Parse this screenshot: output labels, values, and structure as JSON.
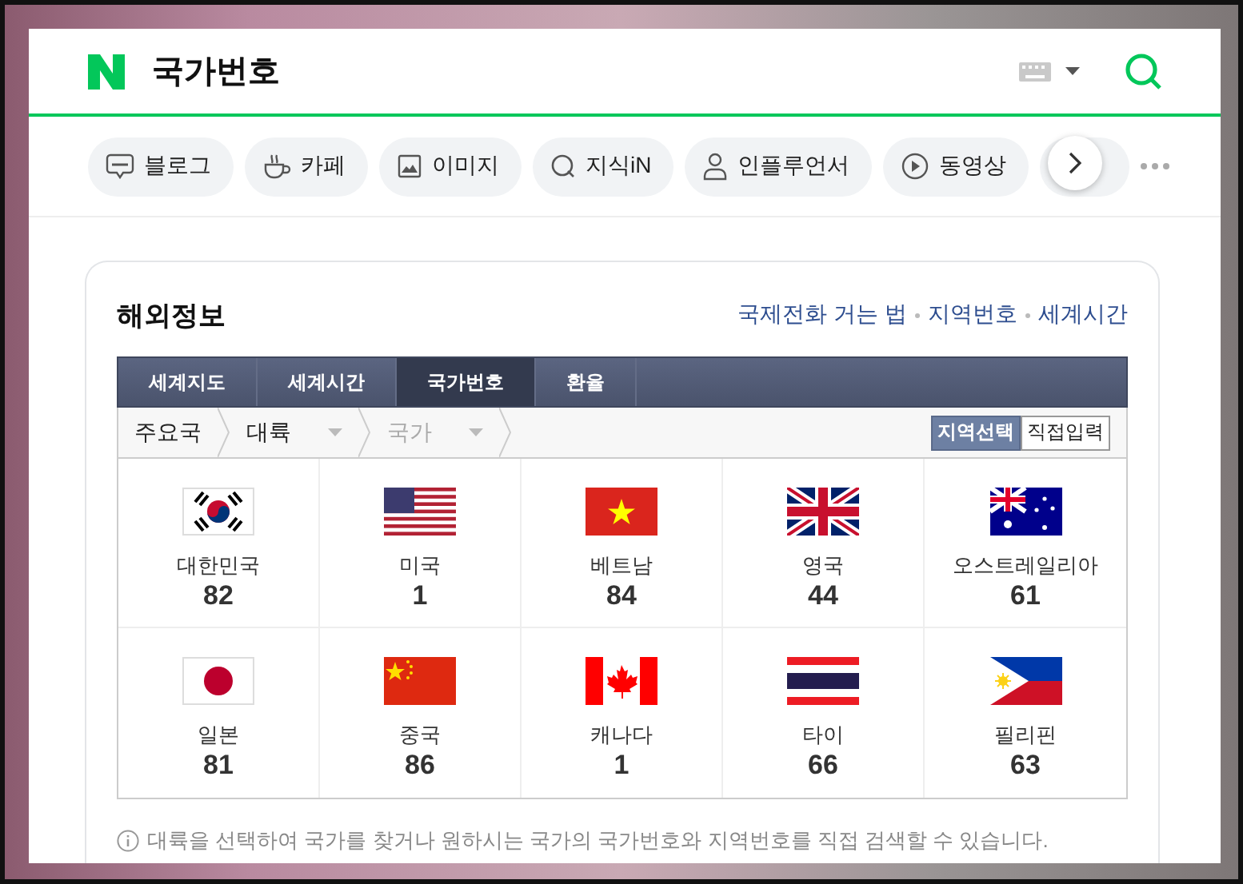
{
  "header": {
    "query": "국가번호"
  },
  "chips": [
    {
      "label": "블로그"
    },
    {
      "label": "카페"
    },
    {
      "label": "이미지"
    },
    {
      "label": "지식iN"
    },
    {
      "label": "인플루언서"
    },
    {
      "label": "동영상"
    }
  ],
  "card": {
    "title": "해외정보",
    "links": [
      "국제전화 거는 법",
      "지역번호",
      "세계시간"
    ],
    "tabs": [
      {
        "label": "세계지도",
        "selected": false
      },
      {
        "label": "세계시간",
        "selected": false
      },
      {
        "label": "국가번호",
        "selected": true
      },
      {
        "label": "환율",
        "selected": false
      }
    ],
    "filters": [
      {
        "label": "주요국",
        "kind": "crumb",
        "disabled": false
      },
      {
        "label": "대륙",
        "kind": "select",
        "disabled": false
      },
      {
        "label": "국가",
        "kind": "select",
        "disabled": true
      }
    ],
    "modes": [
      {
        "label": "지역선택",
        "selected": true
      },
      {
        "label": "직접입력",
        "selected": false
      }
    ],
    "countries": [
      {
        "name": "대한민국",
        "code": "82"
      },
      {
        "name": "미국",
        "code": "1"
      },
      {
        "name": "베트남",
        "code": "84"
      },
      {
        "name": "영국",
        "code": "44"
      },
      {
        "name": "오스트레일리아",
        "code": "61"
      },
      {
        "name": "일본",
        "code": "81"
      },
      {
        "name": "중국",
        "code": "86"
      },
      {
        "name": "캐나다",
        "code": "1"
      },
      {
        "name": "타이",
        "code": "66"
      },
      {
        "name": "필리핀",
        "code": "63"
      }
    ],
    "note": "대륙을 선택하여 국가를 찾거나 원하시는 국가의 국가번호와 지역번호를 직접 검색할 수 있습니다."
  }
}
